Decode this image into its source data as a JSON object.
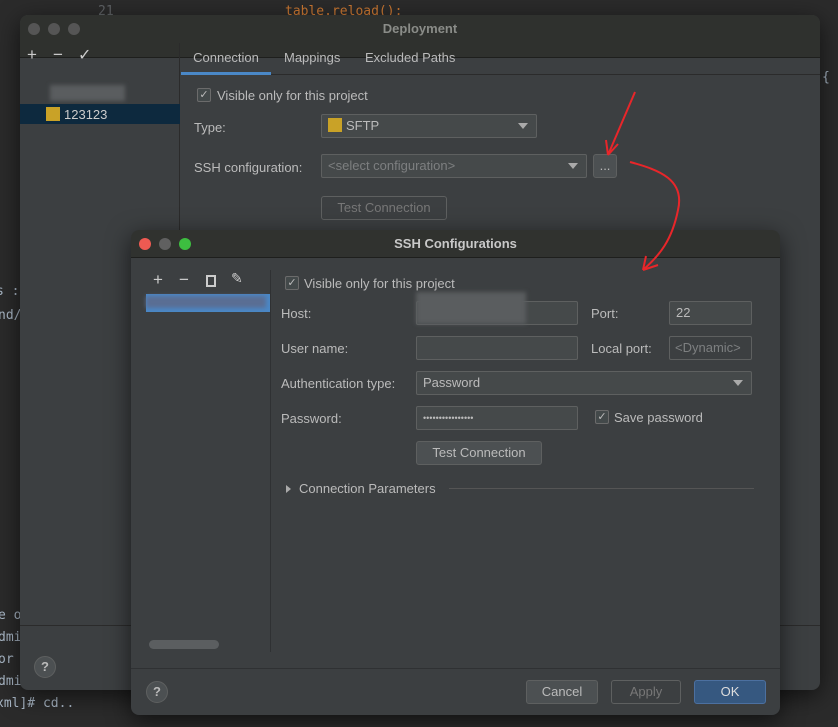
{
  "editor": {
    "line_number": "21",
    "code_line": "table.reload();",
    "brace": "{",
    "left_fragments": [
      "s :",
      "nd/",
      "e o",
      "dmi",
      "or",
      "dmi",
      "xml]# cd.."
    ]
  },
  "deployment": {
    "title": "Deployment",
    "toolbar": {
      "add": "+",
      "remove": "−",
      "check": "✓"
    },
    "servers": [
      {
        "name": "123123",
        "icon": "sftp-server-icon",
        "selected": true
      }
    ],
    "tabs": [
      {
        "label": "Connection",
        "active": true
      },
      {
        "label": "Mappings"
      },
      {
        "label": "Excluded Paths"
      }
    ],
    "visible_only": {
      "label": "Visible only for this project",
      "checked": true
    },
    "type_label": "Type:",
    "type_value": "SFTP",
    "ssh_label": "SSH configuration:",
    "ssh_placeholder": "<select configuration>",
    "browse_label": "...",
    "test_connection": "Test Connection",
    "help": "?"
  },
  "ssh": {
    "title": "SSH Configurations",
    "toolbar": {
      "add": "+",
      "remove": "−",
      "copy": "copy-icon",
      "edit": "edit-icon"
    },
    "visible_only": {
      "label": "Visible only for this project",
      "checked": true
    },
    "host_label": "Host:",
    "host_value": "",
    "port_label": "Port:",
    "port_value": "22",
    "user_label": "User name:",
    "user_value": "",
    "local_port_label": "Local port:",
    "local_port_placeholder": "<Dynamic>",
    "auth_label": "Authentication type:",
    "auth_value": "Password",
    "password_label": "Password:",
    "password_value": "••••••••••••••••",
    "save_password": {
      "label": "Save password",
      "checked": true
    },
    "test_connection": "Test Connection",
    "connection_params": "Connection Parameters",
    "help": "?",
    "cancel": "Cancel",
    "apply": "Apply",
    "ok": "OK"
  },
  "colors": {
    "accent": "#4a88c7",
    "ok": "#365880",
    "annotation": "#e8262a"
  }
}
